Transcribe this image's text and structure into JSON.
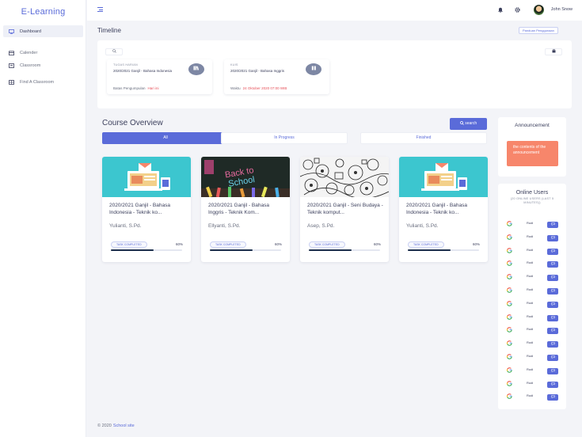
{
  "app": {
    "brand": "E-Learning"
  },
  "sidebar": {
    "items": [
      {
        "label": "Dashboard",
        "icon": "monitor-icon"
      },
      {
        "label": "Calender",
        "icon": "calendar-icon"
      },
      {
        "label": "Classroom",
        "icon": "classroom-icon"
      },
      {
        "label": "Find A Classroom",
        "icon": "grid-icon"
      }
    ]
  },
  "header": {
    "username": "John Snow"
  },
  "timeline": {
    "title": "Timeline",
    "guide_button": "Panduan Penggunaan",
    "items": [
      {
        "kind": "TUGAS HARIAN",
        "title": "2020/2021 Ganjil - Bahasa Indonesia",
        "meta_label": "Batas Pengumpulan",
        "meta_value": "Hari ini"
      },
      {
        "kind": "KUIS",
        "title": "2020/2021 Ganjil - Bahasa Inggris",
        "meta_label": "Waktu",
        "meta_value": "24 Oktober 2020 07:00 WIB"
      }
    ]
  },
  "courses": {
    "title": "Course Overview",
    "search_label": "search",
    "tabs": [
      "All",
      "In Progress",
      "Finished"
    ],
    "items": [
      {
        "title": "2020/2021 Ganjil - Bahasa Indonesia - Teknik ko...",
        "teacher": "Yulianti, S.Pd.",
        "badge": "TASK COMPLETED",
        "progress": "60%",
        "progress_value": 0.6
      },
      {
        "title": "2020/2021 Ganjil - Bahasa Inggris - Teknik Kom...",
        "teacher": "Ellyanti, S.Pd.",
        "badge": "TASK COMPLETED",
        "progress": "60%",
        "progress_value": 0.6
      },
      {
        "title": "2020/2021 Ganjil - Seni Budaya - Teknik komput...",
        "teacher": "Asep, S.Pd.",
        "badge": "TASK COMPLETED",
        "progress": "60%",
        "progress_value": 0.6
      },
      {
        "title": "2020/2021 Ganjil - Bahasa Indonesia - Teknik ko...",
        "teacher": "Yulianti, S.Pd.",
        "badge": "TASK COMPLETED",
        "progress": "60%",
        "progress_value": 0.6
      }
    ]
  },
  "announcement": {
    "title": "Announcement",
    "content": "the contents of the announcement"
  },
  "online_users": {
    "title": "Online Users",
    "subtitle": "(20 ONLINE USERS (LAST 5 MINUTES))",
    "users": [
      "Rudi",
      "Rudi",
      "Rudi",
      "Rudi",
      "Rudi",
      "Rudi",
      "Rudi",
      "Rudi",
      "Rudi",
      "Rudi",
      "Rudi",
      "Rudi",
      "Rudi",
      "Rudi"
    ]
  },
  "footer": {
    "copyright": "© 2020",
    "site": "School site"
  },
  "colors": {
    "accent": "#5a6bd9",
    "announcement": "#f7866b",
    "danger": "#e7515a",
    "background": "#f3f4f8"
  }
}
